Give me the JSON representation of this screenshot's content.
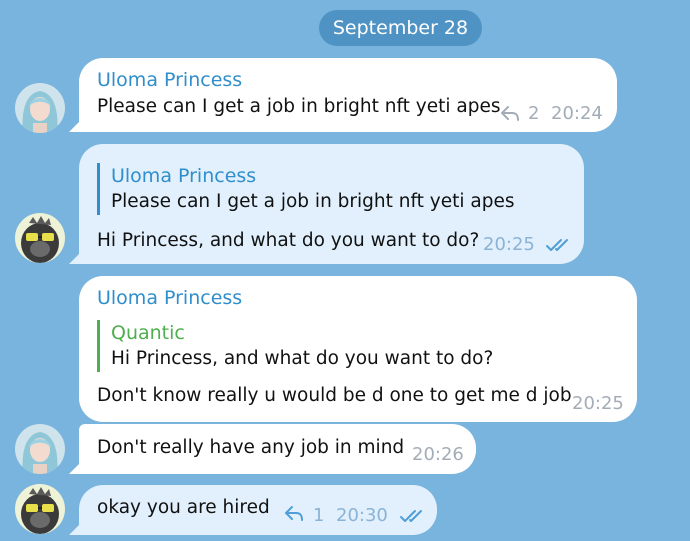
{
  "date_label": "September 28",
  "messages": [
    {
      "sender": "Uloma Princess",
      "text": "Please can I get a job in bright nft yeti apes",
      "replies": "2",
      "time": "20:24"
    },
    {
      "reply_to": {
        "name": "Uloma Princess",
        "text": "Please can I get a job in bright nft yeti apes"
      },
      "text": "Hi Princess, and what do you want to do?",
      "time": "20:25",
      "status_icon": "double-check-icon"
    },
    {
      "sender": "Uloma Princess",
      "reply_to": {
        "name": "Quantic",
        "text": "Hi Princess, and what do you want to do?"
      },
      "text": "Don't know really u would be d one to get me d job",
      "time": "20:25"
    },
    {
      "text": "Don't really have any job in mind",
      "time": "20:26"
    },
    {
      "text": "okay you are hired",
      "replies": "1",
      "time": "20:30",
      "status_icon": "double-check-icon"
    }
  ],
  "colors": {
    "background": "#78b4dd",
    "date_pill": "#4e93c4",
    "sender_name": "#2f8ecb",
    "quantic_name": "#4fae4e",
    "outgoing_bubble": "#e1f0fc"
  }
}
